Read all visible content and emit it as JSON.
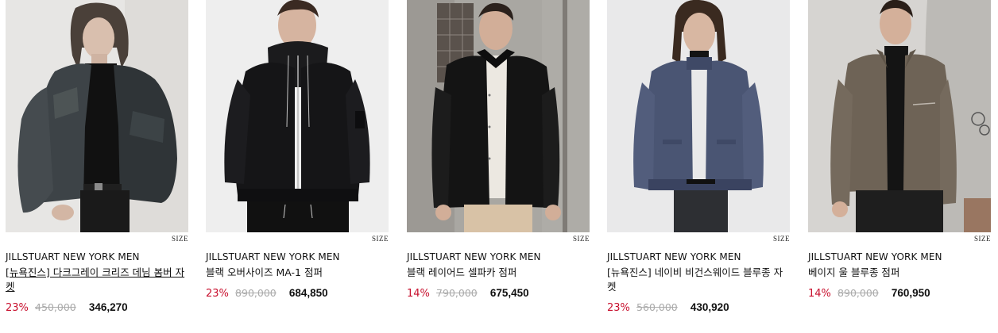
{
  "colors": {
    "discount": "#c8102e",
    "original_price": "#aaaaaa",
    "text": "#111111"
  },
  "products": [
    {
      "image_icon": "product-photo-icon",
      "size_label": "SIZE",
      "brand": "JILLSTUART NEW YORK MEN",
      "name": "[뉴욕진스] 다크그레이 크리즈 데님 봄버 자켓",
      "discount": "23%",
      "original_price": "450,000",
      "sale_price": "346,270"
    },
    {
      "image_icon": "product-photo-icon",
      "size_label": "SIZE",
      "brand": "JILLSTUART NEW YORK MEN",
      "name": "블랙 오버사이즈 MA-1 점퍼",
      "discount": "23%",
      "original_price": "890,000",
      "sale_price": "684,850"
    },
    {
      "image_icon": "product-photo-icon",
      "size_label": "SIZE",
      "brand": "JILLSTUART NEW YORK MEN",
      "name": "블랙 레이어드 셀파카 점퍼",
      "discount": "14%",
      "original_price": "790,000",
      "sale_price": "675,450"
    },
    {
      "image_icon": "product-photo-icon",
      "size_label": "SIZE",
      "brand": "JILLSTUART NEW YORK MEN",
      "name": "[뉴욕진스] 네이비 비건스웨이드 블루종 자켓",
      "discount": "23%",
      "original_price": "560,000",
      "sale_price": "430,920"
    },
    {
      "image_icon": "product-photo-icon",
      "size_label": "SIZE",
      "brand": "JILLSTUART NEW YORK MEN",
      "name": "베이지 울 블루종 점퍼",
      "discount": "14%",
      "original_price": "890,000",
      "sale_price": "760,950"
    }
  ]
}
